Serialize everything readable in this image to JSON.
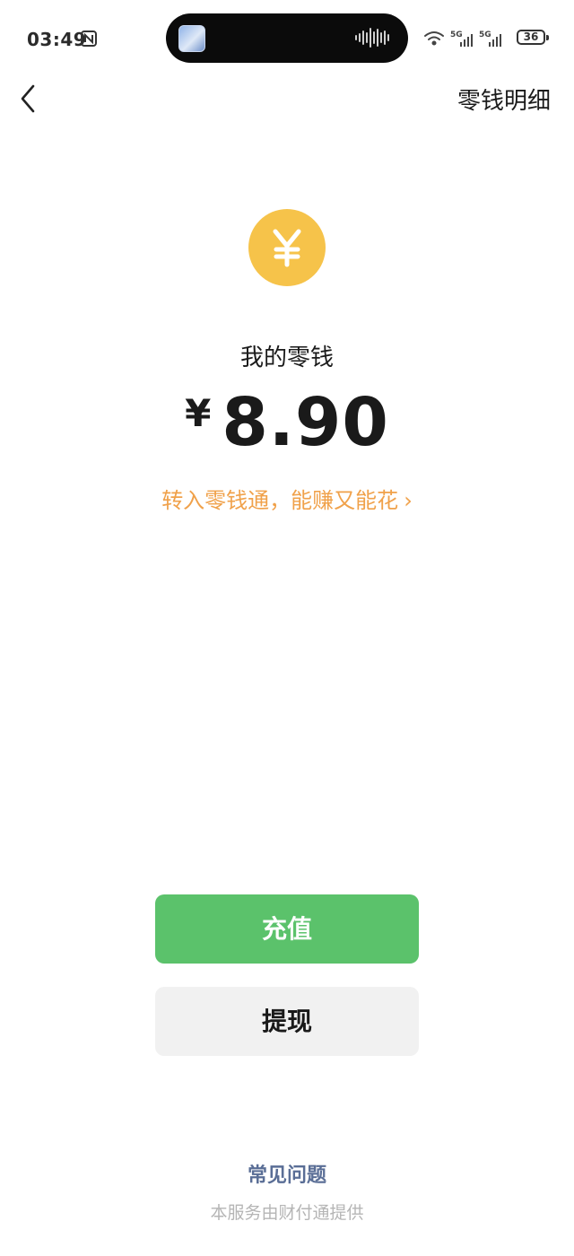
{
  "status_bar": {
    "time": "03:49",
    "battery": "36",
    "network_labels": [
      "5G",
      "5G"
    ]
  },
  "nav": {
    "back_icon": "chevron-left-icon",
    "detail_link": "零钱明细"
  },
  "balance": {
    "coin_icon": "yuan-coin-icon",
    "label": "我的零钱",
    "currency": "¥",
    "amount": "8.90",
    "promo": "转入零钱通，能赚又能花",
    "promo_chevron": "›"
  },
  "actions": {
    "recharge_label": "充值",
    "withdraw_label": "提现"
  },
  "footer": {
    "faq": "常见问题",
    "provider": "本服务由财付通提供"
  },
  "colors": {
    "coin": "#f6c34a",
    "promo": "#f0a14a",
    "recharge_button": "#5bc26b",
    "withdraw_button": "#f1f1f1",
    "faq": "#5a6e96"
  }
}
